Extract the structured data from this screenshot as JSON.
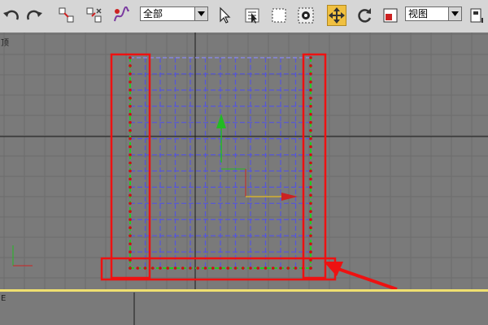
{
  "toolbar": {
    "selection_filter": "全部",
    "reference_coord": "视图",
    "buttons": [
      {
        "name": "undo-icon"
      },
      {
        "name": "redo-icon"
      },
      {
        "name": "select-and-link-icon"
      },
      {
        "name": "unlink-selection-icon"
      },
      {
        "name": "bind-to-space-warp-icon"
      },
      {
        "name": "select-object-icon"
      },
      {
        "name": "select-by-name-icon"
      },
      {
        "name": "rectangular-selection-icon"
      },
      {
        "name": "window-crossing-icon"
      },
      {
        "name": "select-and-move-icon"
      },
      {
        "name": "select-and-rotate-icon"
      },
      {
        "name": "select-and-scale-icon"
      }
    ]
  },
  "viewport": {
    "label": "顶",
    "grid": {
      "columns": 12,
      "rows": 13
    },
    "highlight_color": "#ee1111",
    "lattice_color": "#5555dd",
    "edge_color": "#22cc22",
    "vertex_color": "#cc1111"
  },
  "bottom_viewport": {
    "label": "E"
  }
}
